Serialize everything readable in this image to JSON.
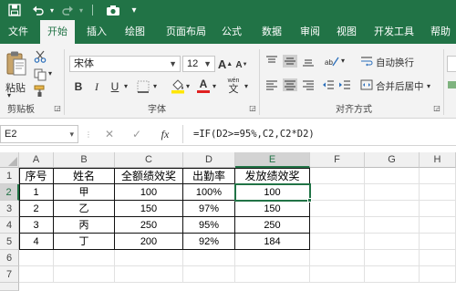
{
  "titlebar": {
    "icons": [
      "save-icon",
      "undo-icon",
      "redo-icon",
      "camera-icon",
      "customize-quick-access-icon"
    ]
  },
  "tabs": [
    "文件",
    "开始",
    "插入",
    "绘图",
    "页面布局",
    "公式",
    "数据",
    "审阅",
    "视图",
    "开发工具",
    "帮助"
  ],
  "active_tab": "开始",
  "ribbon": {
    "clipboard": {
      "paste_label": "粘贴",
      "group_label": "剪贴板"
    },
    "font": {
      "font_name": "宋体",
      "font_size": "12",
      "grow_label": "A",
      "shrink_label": "A",
      "bold_label": "B",
      "italic_label": "I",
      "underline_label": "U",
      "font_color_label": "A",
      "phonetic_label": "wén",
      "group_label": "字体"
    },
    "alignment": {
      "wrap_text_label": "自动换行",
      "merge_center_label": "合并后居中",
      "group_label": "对齐方式"
    }
  },
  "formula_bar": {
    "name_box": "E2",
    "cancel_label": "✕",
    "enter_label": "✓",
    "fx_label": "fx",
    "formula": "=IF(D2>=95%,C2,C2*D2)"
  },
  "grid": {
    "columns": [
      "A",
      "B",
      "C",
      "D",
      "E",
      "F",
      "G",
      "H"
    ],
    "rows": [
      "1",
      "2",
      "3",
      "4",
      "5",
      "6",
      "7",
      "8"
    ],
    "selected_cell": "E2",
    "data": [
      [
        "序号",
        "姓名",
        "全额绩效奖",
        "出勤率",
        "发放绩效奖"
      ],
      [
        "1",
        "甲",
        "100",
        "100%",
        "100"
      ],
      [
        "2",
        "乙",
        "150",
        "97%",
        "150"
      ],
      [
        "3",
        "丙",
        "250",
        "95%",
        "250"
      ],
      [
        "4",
        "丁",
        "200",
        "92%",
        "184"
      ]
    ]
  },
  "colors": {
    "excel_green": "#217346",
    "ribbon_bg": "#f3f3f3",
    "font_color_swatch": "#e02020",
    "fill_color_swatch": "#ffe600"
  }
}
